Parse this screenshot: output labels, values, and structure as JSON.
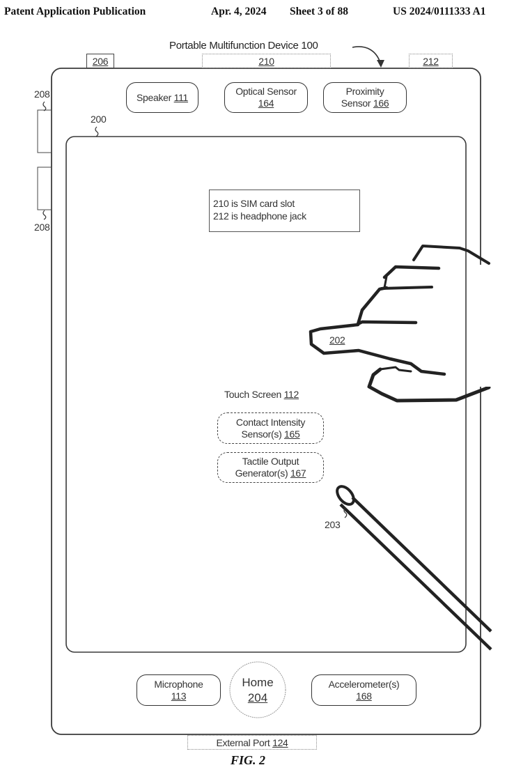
{
  "header": {
    "publication": "Patent Application Publication",
    "date": "Apr. 4, 2024",
    "sheet": "Sheet 3 of 88",
    "number": "US 2024/0111333 A1"
  },
  "figure": {
    "device_title": "Portable Multifunction Device 100",
    "caption": "FIG. 2",
    "top_ports": {
      "left": "206",
      "center": "210",
      "right": "212"
    },
    "side_buttons": {
      "upper_ref": "208",
      "lower_ref": "208"
    },
    "screen_ref": "200",
    "top_components": [
      {
        "name": "Speaker",
        "ref": "111"
      },
      {
        "name": "Optical Sensor",
        "ref": "164"
      },
      {
        "name": "Proximity",
        "name2": "Sensor",
        "ref": "166"
      }
    ],
    "note": {
      "line1": "210 is SIM card slot",
      "line2": "212 is headphone jack"
    },
    "finger_ref": "202",
    "stylus_ref": "203",
    "touch_screen": {
      "name": "Touch Screen",
      "ref": "112"
    },
    "internal_components": [
      {
        "line1": "Contact Intensity",
        "line2": "Sensor(s)",
        "ref": "165"
      },
      {
        "line1": "Tactile Output",
        "line2": "Generator(s)",
        "ref": "167"
      }
    ],
    "bottom_components": {
      "microphone": {
        "name": "Microphone",
        "ref": "113"
      },
      "home": {
        "name": "Home",
        "ref": "204"
      },
      "accelerometer": {
        "name": "Accelerometer(s)",
        "ref": "168"
      }
    },
    "external_port": {
      "name": "External Port",
      "ref": "124"
    }
  }
}
